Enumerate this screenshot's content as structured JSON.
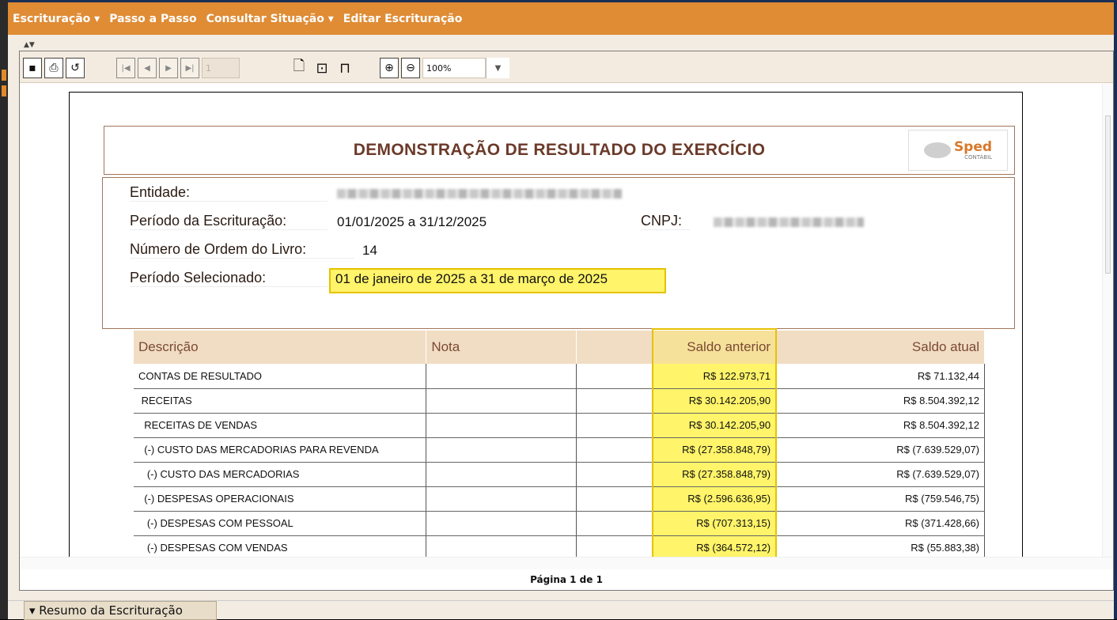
{
  "menu": {
    "items": [
      {
        "label": "Escrituração ▾"
      },
      {
        "label": "Passo a Passo"
      },
      {
        "label": "Consultar Situação ▾"
      },
      {
        "label": "Editar Escrituração"
      }
    ]
  },
  "toolbar": {
    "page_number": "1",
    "zoom": "100%"
  },
  "report": {
    "title": "DEMONSTRAÇÃO DE RESULTADO DO EXERCÍCIO",
    "logo_text": "Sped",
    "logo_sub": "CONTÁBIL",
    "entidade_label": "Entidade:",
    "periodo_label": "Período da Escrituração:",
    "periodo_value": "01/01/2025 a 31/12/2025",
    "cnpj_label": "CNPJ:",
    "ordem_label": "Número de Ordem do Livro:",
    "ordem_value": "14",
    "selecionado_label": "Período Selecionado:",
    "selecionado_value": "01 de janeiro de 2025 a 31 de março de 2025"
  },
  "table": {
    "headers": [
      "Descrição",
      "Nota",
      "",
      "Saldo anterior",
      "Saldo atual"
    ],
    "rows": [
      {
        "desc": "CONTAS DE RESULTADO",
        "anterior": "R$ 122.973,71",
        "atual": "R$ 71.132,44"
      },
      {
        "desc": " RECEITAS",
        "anterior": "R$ 30.142.205,90",
        "atual": "R$ 8.504.392,12"
      },
      {
        "desc": "  RECEITAS DE VENDAS",
        "anterior": "R$ 30.142.205,90",
        "atual": "R$ 8.504.392,12"
      },
      {
        "desc": "  (-) CUSTO DAS MERCADORIAS PARA REVENDA",
        "anterior": "R$ (27.358.848,79)",
        "atual": "R$ (7.639.529,07)"
      },
      {
        "desc": "   (-) CUSTO DAS MERCADORIAS",
        "anterior": "R$ (27.358.848,79)",
        "atual": "R$ (7.639.529,07)"
      },
      {
        "desc": "  (-) DESPESAS OPERACIONAIS",
        "anterior": "R$ (2.596.636,95)",
        "atual": "R$ (759.546,75)"
      },
      {
        "desc": "   (-) DESPESAS COM PESSOAL",
        "anterior": "R$ (707.313,15)",
        "atual": "R$ (371.428,66)"
      },
      {
        "desc": "   (-) DESPESAS COM VENDAS",
        "anterior": "R$ (364.572,12)",
        "atual": "R$ (55.883,38)"
      }
    ]
  },
  "footer": {
    "page_info": "Página 1 de 1",
    "summary_tab": "▾ Resumo da Escrituração"
  }
}
